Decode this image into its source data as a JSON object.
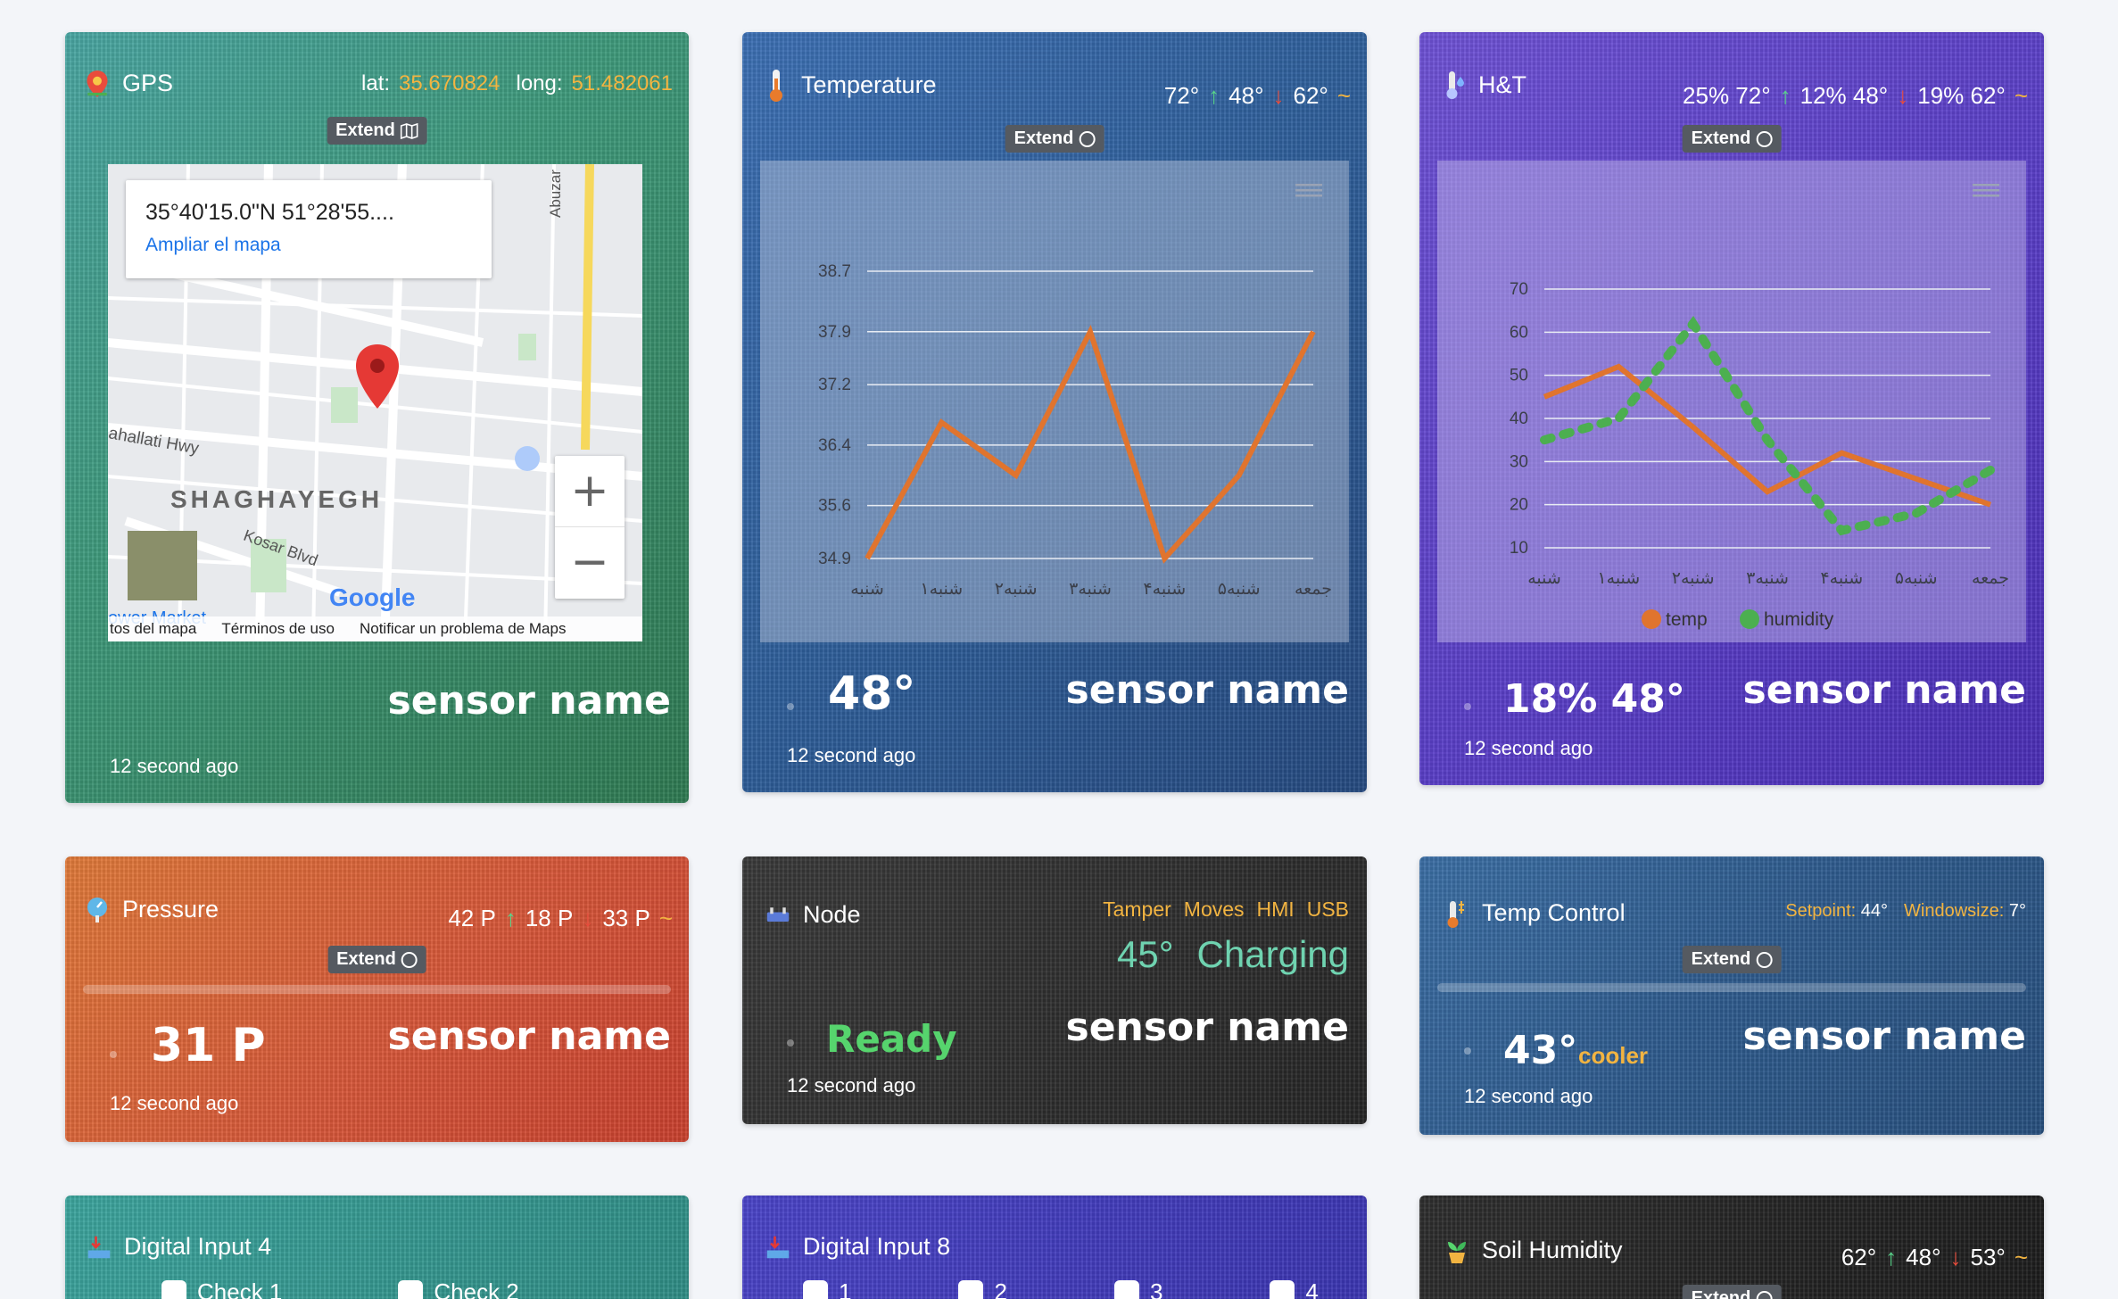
{
  "gps": {
    "title": "GPS",
    "lat_label": "lat:",
    "lat": "35.670824",
    "long_label": "long:",
    "long": "51.482061",
    "extend": "Extend",
    "map": {
      "coords": "35°40'15.0\"N 51°28'55....",
      "enlarge": "Ampliar el mapa",
      "district": "SHAGHAYEGH",
      "labels": [
        "Abuzar Blvd",
        "ahallati Hwy",
        "Kosar Blvd",
        "ower Market",
        "Google"
      ],
      "footer": [
        "tos del mapa",
        "Términos de uso",
        "Notificar un problema de Maps"
      ],
      "zoom_in": "+",
      "zoom_out": "−"
    },
    "sensor_name": "sensor name",
    "ago": "12 second ago"
  },
  "temperature": {
    "title": "Temperature",
    "current": "72°",
    "max": "48°",
    "min": "62°",
    "trend": "~",
    "extend": "Extend",
    "value": "48°",
    "sensor_name": "sensor name",
    "ago": "12 second ago"
  },
  "ht": {
    "title": "H&T",
    "current": "25% 72°",
    "max": "12% 48°",
    "min": "19% 62°",
    "trend": "~",
    "extend": "Extend",
    "value": "18% 48°",
    "sensor_name": "sensor name",
    "ago": "12 second ago"
  },
  "pressure": {
    "title": "Pressure",
    "current": "42 P",
    "max": "18 P",
    "min": "33 P",
    "trend": "~",
    "extend": "Extend",
    "value": "31 P",
    "sensor_name": "sensor name",
    "ago": "12 second ago"
  },
  "node": {
    "title": "Node",
    "flags": [
      "Tamper",
      "Moves",
      "HMI",
      "USB"
    ],
    "angle": "45°",
    "power": "Charging",
    "status": "Ready",
    "sensor_name": "sensor name",
    "ago": "12 second ago"
  },
  "temp_control": {
    "title": "Temp Control",
    "setpoint_label": "Setpoint:",
    "setpoint": "44°",
    "window_label": "Windowsize:",
    "window": "7°",
    "extend": "Extend",
    "value": "43°",
    "mode": "cooler",
    "sensor_name": "sensor name",
    "ago": "12 second ago"
  },
  "digital4": {
    "title": "Digital Input 4",
    "checks": [
      "Check 1",
      "Check 2"
    ]
  },
  "digital8": {
    "title": "Digital Input 8",
    "checks": [
      "1",
      "2",
      "3",
      "4"
    ]
  },
  "soil": {
    "title": "Soil Humidity",
    "current": "62°",
    "max": "48°",
    "min": "53°",
    "trend": "~",
    "extend": "Extend"
  },
  "colors": {
    "up": "#5ad48b",
    "down": "#e74c3c",
    "accent": "#f2b441",
    "line_orange": "#e0742e",
    "dot_green": "#4caf50"
  },
  "chart_data": [
    {
      "type": "line",
      "categories": [
        "شنبه",
        "۱شنبه",
        "۲شنبه",
        "۳شنبه",
        "۴شنبه",
        "۵شنبه",
        "جمعه"
      ],
      "series": [
        {
          "values": [
            34.9,
            36.7,
            36.0,
            37.9,
            34.9,
            36.0,
            37.9
          ]
        }
      ],
      "yticks": [
        "38.7",
        "37.9",
        "37.2",
        "36.4",
        "35.6",
        "34.9"
      ],
      "ylim": [
        34.9,
        38.7
      ]
    },
    {
      "type": "line",
      "categories": [
        "شنبه",
        "۱شنبه",
        "۲شنبه",
        "۳شنبه",
        "۴شنبه",
        "۵شنبه",
        "جمعه"
      ],
      "series": [
        {
          "name": "temp",
          "values": [
            45,
            52,
            38,
            23,
            32,
            26,
            20
          ]
        },
        {
          "name": "humidity",
          "values": [
            35,
            40,
            62,
            35,
            14,
            18,
            28
          ]
        }
      ],
      "yticks": [
        "70",
        "60",
        "50",
        "40",
        "30",
        "20",
        "10"
      ],
      "ylim": [
        10,
        70
      ]
    }
  ]
}
